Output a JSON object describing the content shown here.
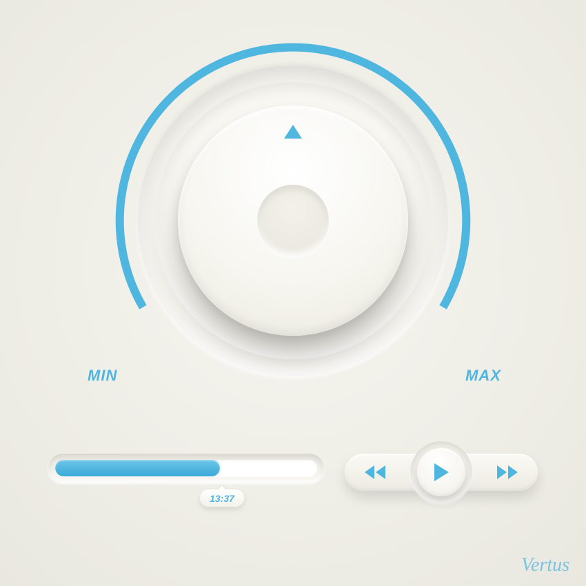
{
  "colors": {
    "accent": "#4fb6e0",
    "background": "#efeee8"
  },
  "dial": {
    "min_label": "MIN",
    "max_label": "MAX",
    "value_percent": 50,
    "arc_start_deg": 210,
    "arc_end_deg": -30
  },
  "progress": {
    "percent": 63,
    "time_label": "13:37"
  },
  "transport": {
    "rewind_icon": "rewind-icon",
    "play_icon": "play-icon",
    "forward_icon": "forward-icon"
  },
  "brand": "Vertus"
}
